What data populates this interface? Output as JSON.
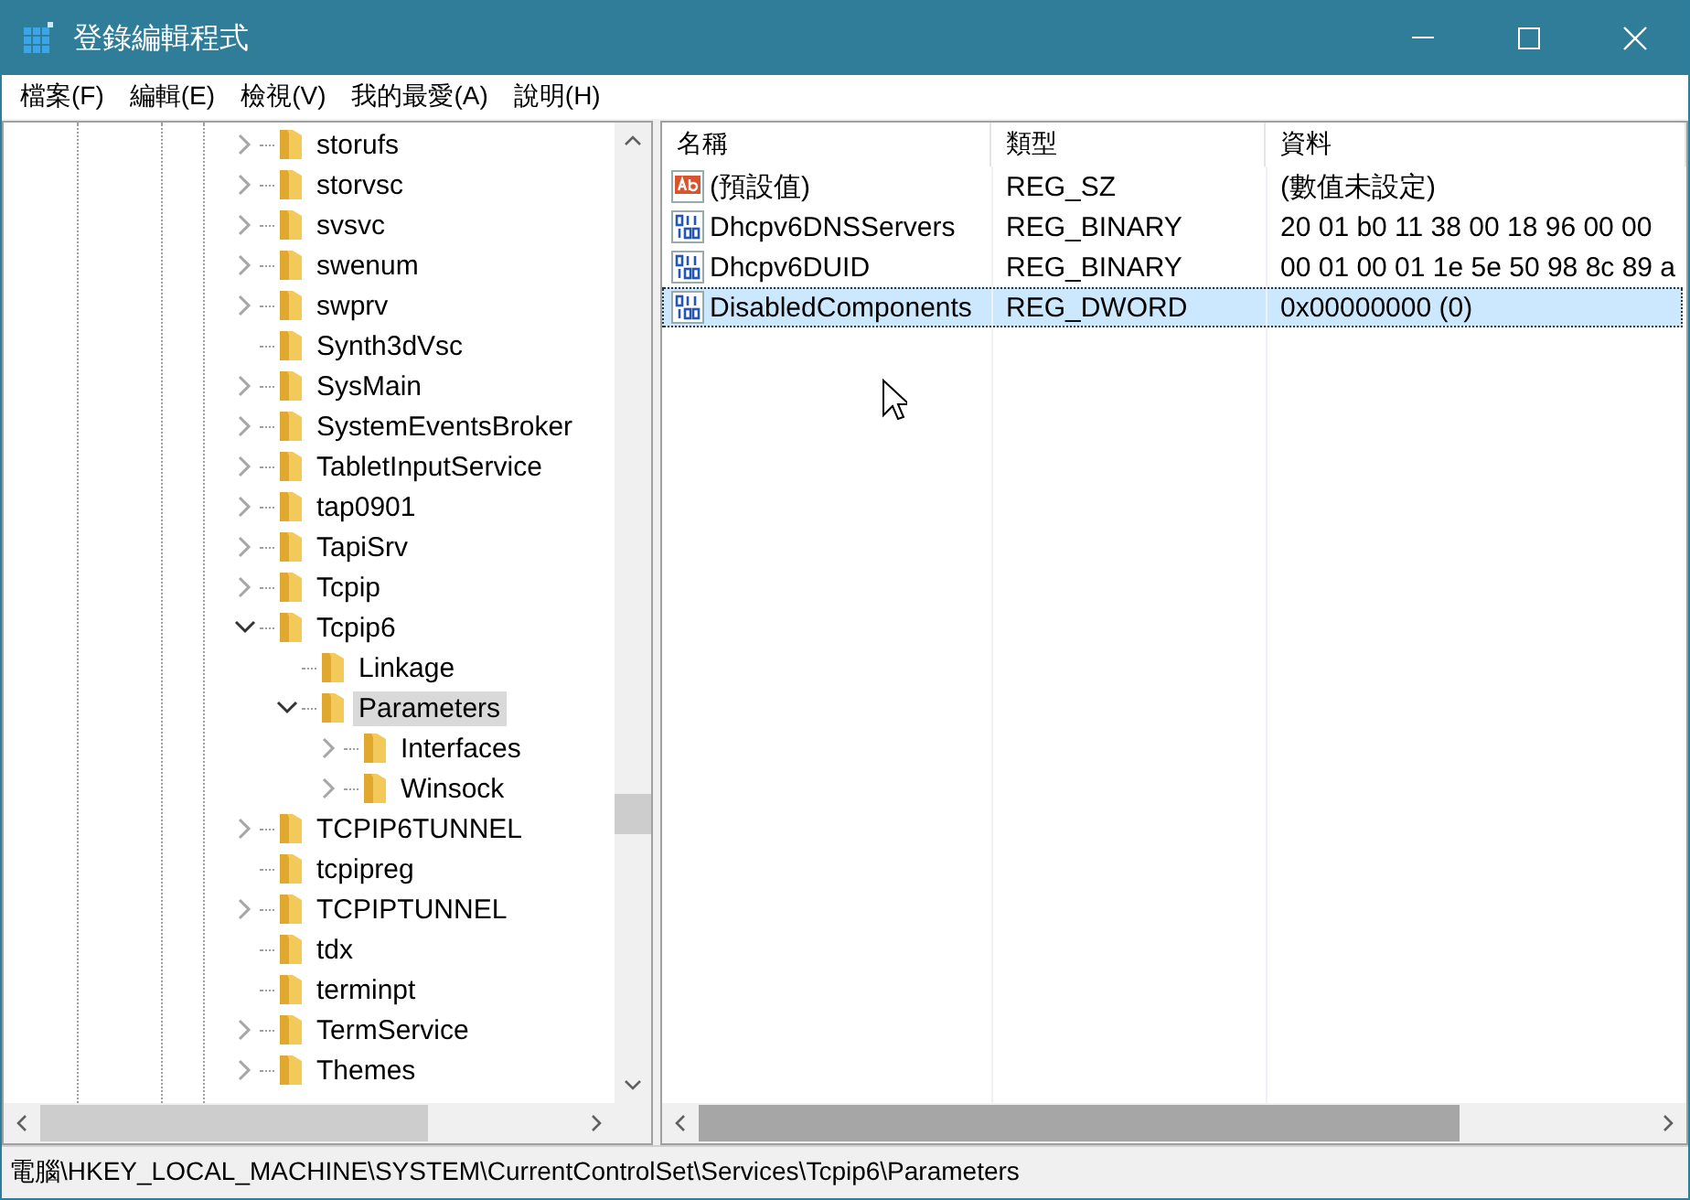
{
  "window": {
    "title": "登錄編輯程式"
  },
  "menu": [
    "檔案(F)",
    "編輯(E)",
    "檢視(V)",
    "我的最愛(A)",
    "說明(H)"
  ],
  "tree": {
    "items": [
      {
        "label": "storufs",
        "expanded": false,
        "selected": false
      },
      {
        "label": "storvsc",
        "expanded": false,
        "selected": false
      },
      {
        "label": "svsvc",
        "expanded": false,
        "selected": false
      },
      {
        "label": "swenum",
        "expanded": false,
        "selected": false
      },
      {
        "label": "swprv",
        "expanded": false,
        "selected": false
      },
      {
        "label": "Synth3dVsc",
        "selected": false
      },
      {
        "label": "SysMain",
        "expanded": false,
        "selected": false
      },
      {
        "label": "SystemEventsBroker",
        "expanded": false,
        "selected": false
      },
      {
        "label": "TabletInputService",
        "expanded": false,
        "selected": false
      },
      {
        "label": "tap0901",
        "expanded": false,
        "selected": false
      },
      {
        "label": "TapiSrv",
        "expanded": false,
        "selected": false
      },
      {
        "label": "Tcpip",
        "expanded": false,
        "selected": false
      },
      {
        "label": "Tcpip6",
        "expanded": true,
        "selected": false,
        "children": [
          {
            "label": "Linkage",
            "selected": false
          },
          {
            "label": "Parameters",
            "expanded": true,
            "selected": true,
            "children": [
              {
                "label": "Interfaces",
                "expanded": false,
                "selected": false
              },
              {
                "label": "Winsock",
                "expanded": false,
                "selected": false
              }
            ]
          }
        ]
      },
      {
        "label": "TCPIP6TUNNEL",
        "expanded": false,
        "selected": false
      },
      {
        "label": "tcpipreg",
        "selected": false
      },
      {
        "label": "TCPIPTUNNEL",
        "expanded": false,
        "selected": false
      },
      {
        "label": "tdx",
        "selected": false
      },
      {
        "label": "terminpt",
        "selected": false
      },
      {
        "label": "TermService",
        "expanded": false,
        "selected": false
      },
      {
        "label": "Themes",
        "expanded": false,
        "selected": false
      }
    ]
  },
  "values": {
    "columns": [
      "名稱",
      "類型",
      "資料"
    ],
    "rows": [
      {
        "kind": "string",
        "name": "(預設值)",
        "type": "REG_SZ",
        "data": "(數值未設定)",
        "selected": false
      },
      {
        "kind": "binary",
        "name": "Dhcpv6DNSServers",
        "type": "REG_BINARY",
        "data": "20 01 b0 11 38 00 18 96 00 00",
        "selected": false
      },
      {
        "kind": "binary",
        "name": "Dhcpv6DUID",
        "type": "REG_BINARY",
        "data": "00 01 00 01 1e 5e 50 98 8c 89 a",
        "selected": false
      },
      {
        "kind": "binary",
        "name": "DisabledComponents",
        "type": "REG_DWORD",
        "data": "0x00000000 (0)",
        "selected": true
      }
    ]
  },
  "status_bar": "電腦\\HKEY_LOCAL_MACHINE\\SYSTEM\\CurrentControlSet\\Services\\Tcpip6\\Parameters"
}
